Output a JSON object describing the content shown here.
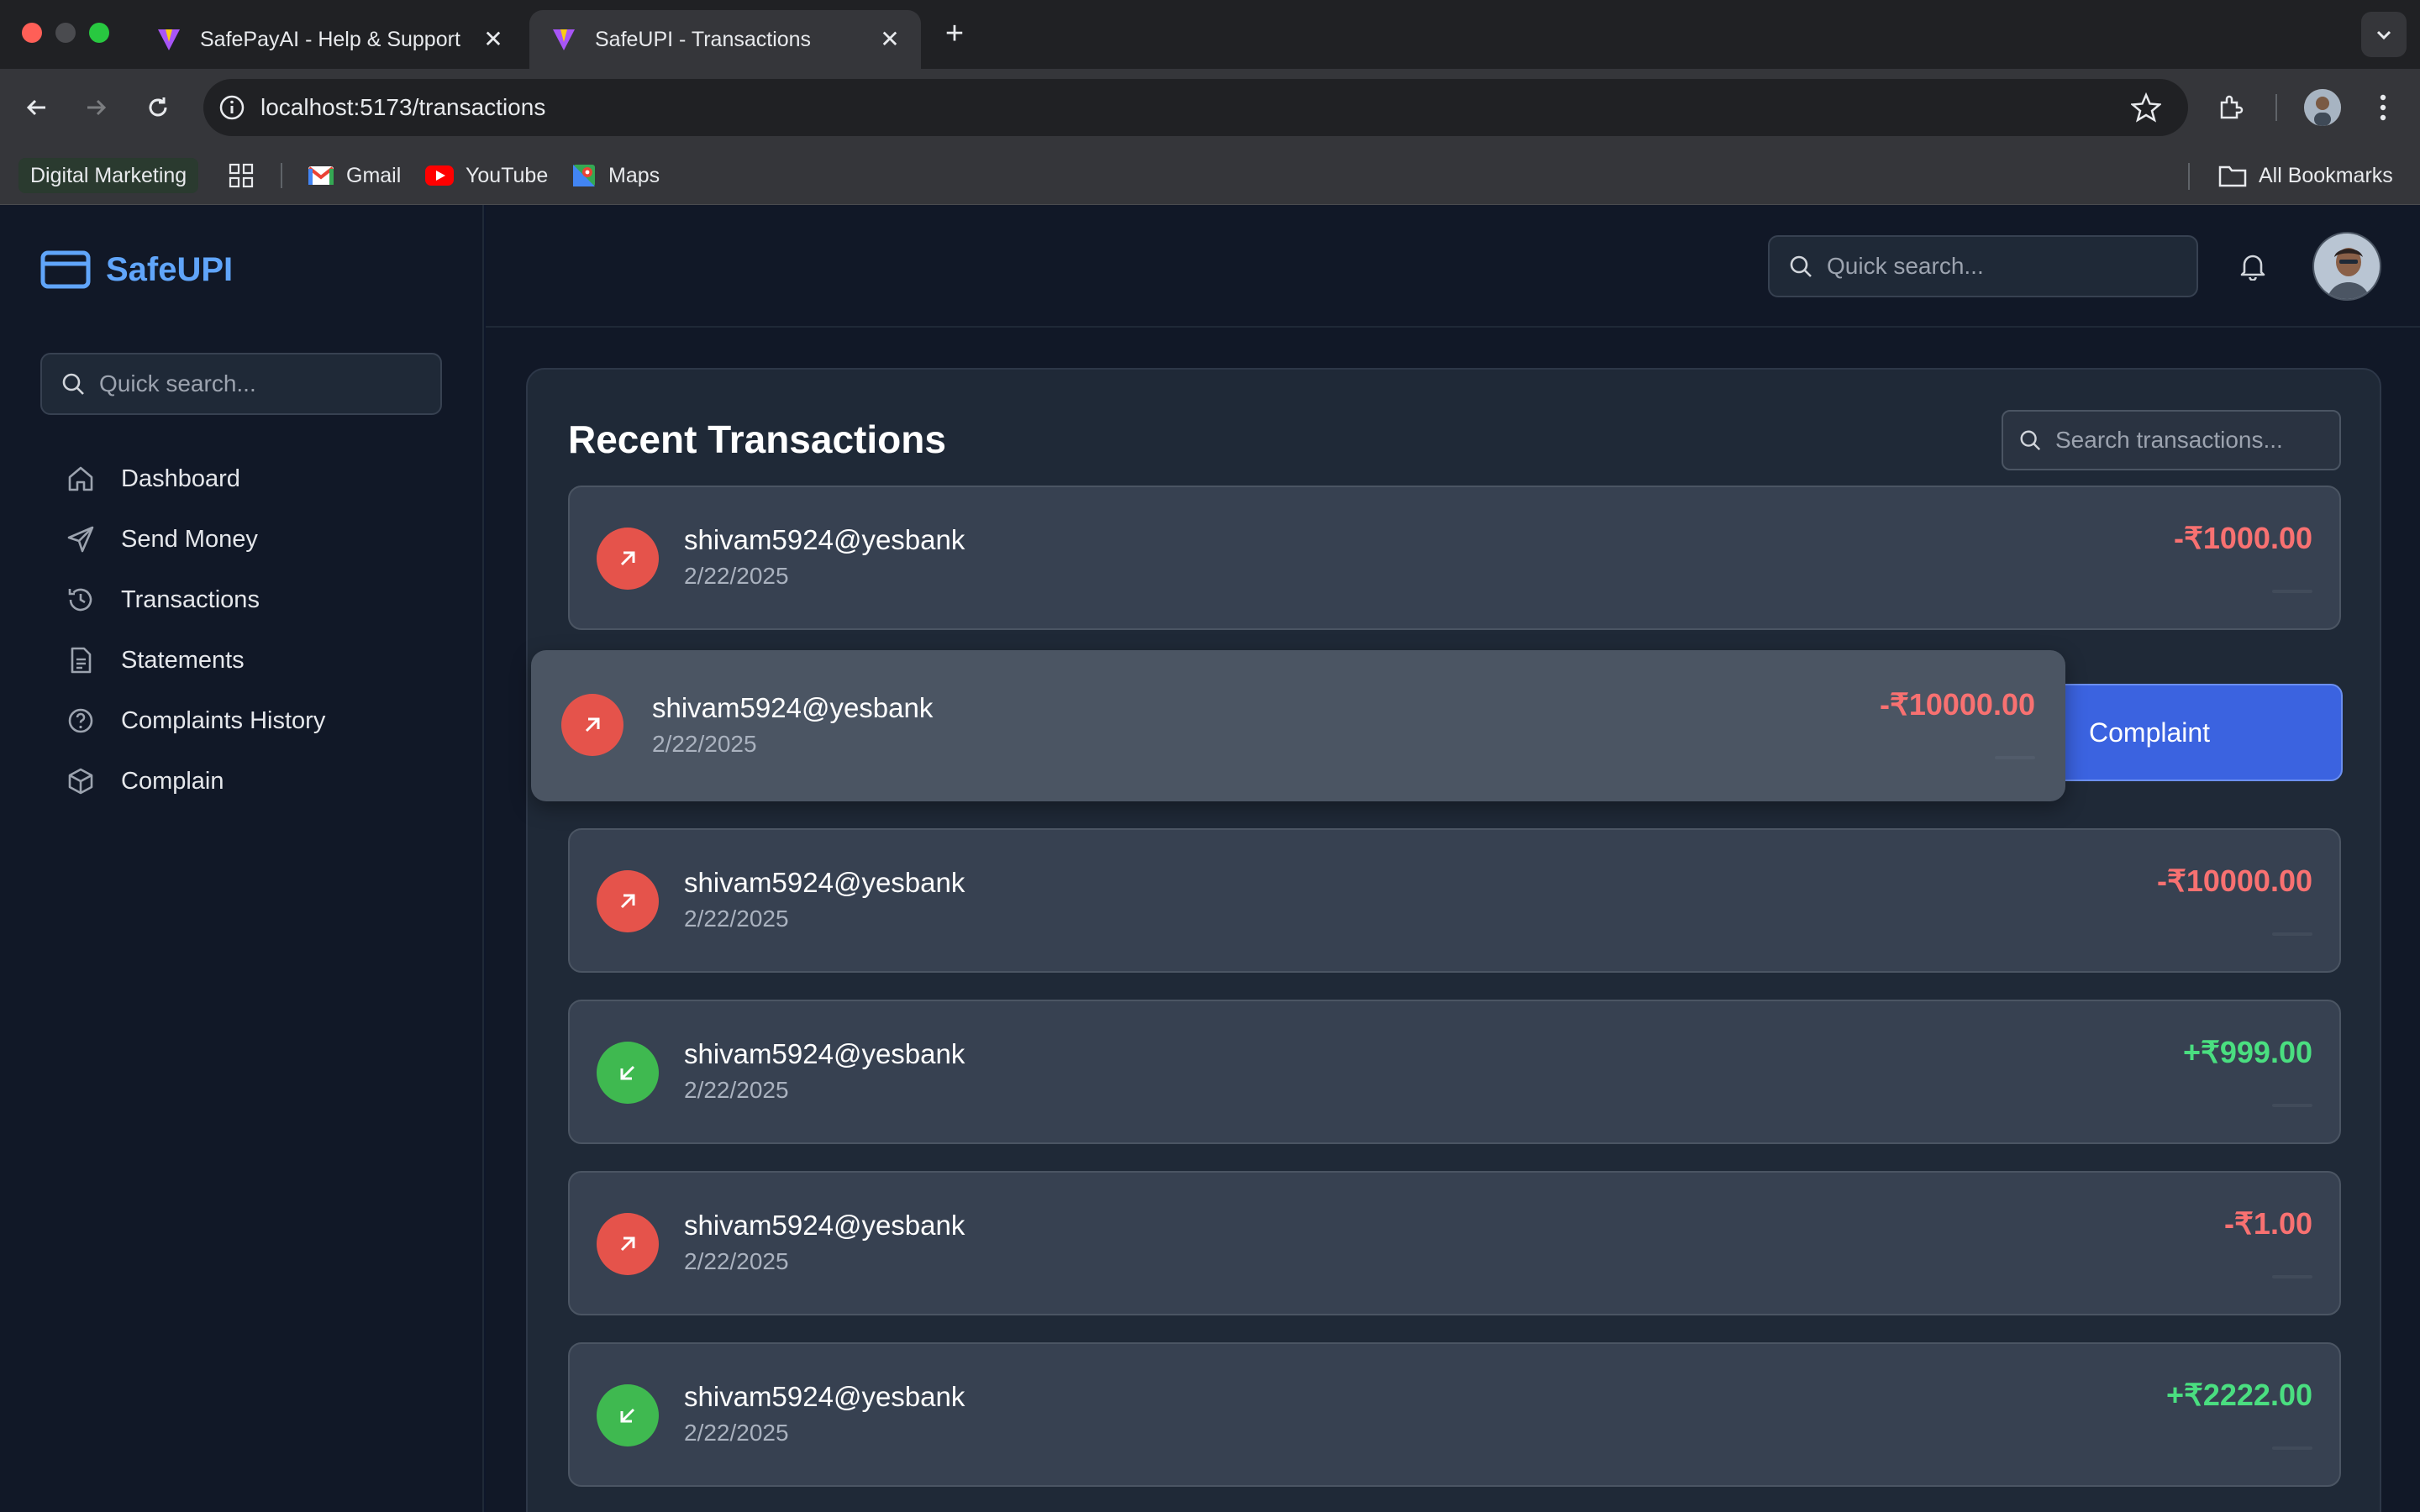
{
  "browser": {
    "tabs": [
      {
        "title": "SafePayAI - Help & Support",
        "active": false
      },
      {
        "title": "SafeUPI - Transactions",
        "active": true
      }
    ],
    "url": "localhost:5173/transactions",
    "bookmarks": {
      "chip": "Digital Marketing",
      "items": [
        "Gmail",
        "YouTube",
        "Maps"
      ],
      "all": "All Bookmarks"
    }
  },
  "sidebar": {
    "logo": "SafeUPI",
    "search_placeholder": "Quick search...",
    "items": [
      {
        "label": "Dashboard",
        "icon": "home-icon"
      },
      {
        "label": "Send Money",
        "icon": "send-icon"
      },
      {
        "label": "Transactions",
        "icon": "history-icon"
      },
      {
        "label": "Statements",
        "icon": "document-icon"
      },
      {
        "label": "Complaints History",
        "icon": "help-circle-icon"
      },
      {
        "label": "Complain",
        "icon": "package-icon"
      }
    ]
  },
  "header": {
    "search_placeholder": "Quick search..."
  },
  "panel": {
    "title": "Recent Transactions",
    "search_placeholder": "Search transactions...",
    "complaint_label": "Complaint",
    "transactions": [
      {
        "name": "shivam5924@yesbank",
        "date": "2/22/2025",
        "amount": "-₹1000.00",
        "direction": "out"
      },
      {
        "name": "shivam5924@yesbank",
        "date": "2/22/2025",
        "amount": "-₹10000.00",
        "direction": "out"
      },
      {
        "name": "shivam5924@yesbank",
        "date": "2/22/2025",
        "amount": "-₹10000.00",
        "direction": "out"
      },
      {
        "name": "shivam5924@yesbank",
        "date": "2/22/2025",
        "amount": "+₹999.00",
        "direction": "in"
      },
      {
        "name": "shivam5924@yesbank",
        "date": "2/22/2025",
        "amount": "-₹1.00",
        "direction": "out"
      },
      {
        "name": "shivam5924@yesbank",
        "date": "2/22/2025",
        "amount": "+₹2222.00",
        "direction": "in"
      }
    ]
  },
  "colors": {
    "accent": "#60a5fa",
    "debit": "#f87171",
    "credit": "#4ade80",
    "complaint": "#3b63e0"
  }
}
